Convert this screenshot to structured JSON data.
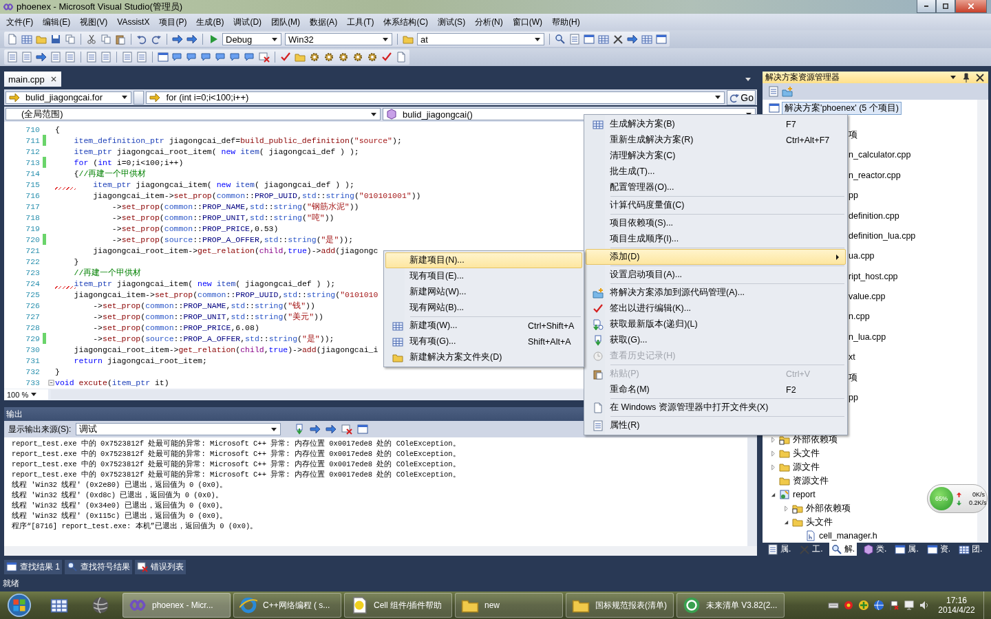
{
  "window": {
    "title": "phoenex - Microsoft Visual Studio(管理员)"
  },
  "menu": [
    "文件(F)",
    "编辑(E)",
    "视图(V)",
    "VAssistX",
    "项目(P)",
    "生成(B)",
    "调试(D)",
    "团队(M)",
    "数据(A)",
    "工具(T)",
    "体系结构(C)",
    "测试(S)",
    "分析(N)",
    "窗口(W)",
    "帮助(H)"
  ],
  "toolbar": {
    "configuration": "Debug",
    "platform": "Win32",
    "find": "at"
  },
  "document_tab": {
    "label": "main.cpp",
    "selected": true
  },
  "navigation": {
    "scope": "bulid_jiagongcai.for",
    "statement": "for (int i=0;i<100;i++)",
    "go": "Go",
    "context": "(全局范围)",
    "member": "bulid_jiagongcai()"
  },
  "code_lines": [
    {
      "number": "710",
      "changed": false,
      "squiggle": false,
      "fold": false,
      "tokens": [
        {
          "kind": "p",
          "text": "{"
        }
      ]
    },
    {
      "number": "711",
      "changed": true,
      "squiggle": false,
      "fold": false,
      "tokens": [
        {
          "kind": "ty",
          "text": "    item_definition_ptr"
        },
        {
          "kind": "p",
          "text": " jiagongcai_def="
        },
        {
          "kind": "fn",
          "text": "build_public_definition"
        },
        {
          "kind": "p",
          "text": "("
        },
        {
          "kind": "str",
          "text": "\"source\""
        },
        {
          "kind": "p",
          "text": ");"
        }
      ]
    },
    {
      "number": "712",
      "changed": false,
      "squiggle": false,
      "fold": false,
      "tokens": [
        {
          "kind": "ty",
          "text": "    item_ptr"
        },
        {
          "kind": "p",
          "text": " jiagongcai_root_item( "
        },
        {
          "kind": "kw",
          "text": "new"
        },
        {
          "kind": "ty",
          "text": " item"
        },
        {
          "kind": "p",
          "text": "( jiagongcai_def ) );"
        }
      ]
    },
    {
      "number": "713",
      "changed": true,
      "squiggle": false,
      "fold": false,
      "tokens": [
        {
          "kind": "kw",
          "text": "    for"
        },
        {
          "kind": "p",
          "text": " ("
        },
        {
          "kind": "kw",
          "text": "int"
        },
        {
          "kind": "p",
          "text": " i=0;i<100;i++)"
        }
      ]
    },
    {
      "number": "714",
      "changed": false,
      "squiggle": false,
      "fold": false,
      "tokens": [
        {
          "kind": "p",
          "text": "    {"
        },
        {
          "kind": "cmt",
          "text": "//再建一个甲供材"
        }
      ]
    },
    {
      "number": "715",
      "changed": false,
      "squiggle": true,
      "fold": false,
      "tokens": [
        {
          "kind": "ty",
          "text": "        item_ptr"
        },
        {
          "kind": "p",
          "text": " jiagongcai_item( "
        },
        {
          "kind": "kw",
          "text": "new"
        },
        {
          "kind": "ty",
          "text": " item"
        },
        {
          "kind": "p",
          "text": "( jiagongcai_def ) );"
        }
      ]
    },
    {
      "number": "716",
      "changed": false,
      "squiggle": false,
      "fold": false,
      "tokens": [
        {
          "kind": "p",
          "text": "        jiagongcai_item->"
        },
        {
          "kind": "fn",
          "text": "set_prop"
        },
        {
          "kind": "p",
          "text": "("
        },
        {
          "kind": "ns",
          "text": "common"
        },
        {
          "kind": "p",
          "text": "::"
        },
        {
          "kind": "mac",
          "text": "PROP_UUID"
        },
        {
          "kind": "p",
          "text": ","
        },
        {
          "kind": "ns",
          "text": "std"
        },
        {
          "kind": "p",
          "text": "::"
        },
        {
          "kind": "ns",
          "text": "string"
        },
        {
          "kind": "p",
          "text": "("
        },
        {
          "kind": "str",
          "text": "\"010101001\""
        },
        {
          "kind": "p",
          "text": "))"
        }
      ]
    },
    {
      "number": "717",
      "changed": false,
      "squiggle": false,
      "fold": false,
      "tokens": [
        {
          "kind": "p",
          "text": "            ->"
        },
        {
          "kind": "fn",
          "text": "set_prop"
        },
        {
          "kind": "p",
          "text": "("
        },
        {
          "kind": "ns",
          "text": "common"
        },
        {
          "kind": "p",
          "text": "::"
        },
        {
          "kind": "mac",
          "text": "PROP_NAME"
        },
        {
          "kind": "p",
          "text": ","
        },
        {
          "kind": "ns",
          "text": "std"
        },
        {
          "kind": "p",
          "text": "::"
        },
        {
          "kind": "ns",
          "text": "string"
        },
        {
          "kind": "p",
          "text": "("
        },
        {
          "kind": "str",
          "text": "\"钢筋水泥\""
        },
        {
          "kind": "p",
          "text": "))"
        }
      ]
    },
    {
      "number": "718",
      "changed": false,
      "squiggle": false,
      "fold": false,
      "tokens": [
        {
          "kind": "p",
          "text": "            ->"
        },
        {
          "kind": "fn",
          "text": "set_prop"
        },
        {
          "kind": "p",
          "text": "("
        },
        {
          "kind": "ns",
          "text": "common"
        },
        {
          "kind": "p",
          "text": "::"
        },
        {
          "kind": "mac",
          "text": "PROP_UNIT"
        },
        {
          "kind": "p",
          "text": ","
        },
        {
          "kind": "ns",
          "text": "std"
        },
        {
          "kind": "p",
          "text": "::"
        },
        {
          "kind": "ns",
          "text": "string"
        },
        {
          "kind": "p",
          "text": "("
        },
        {
          "kind": "str",
          "text": "\"吨\""
        },
        {
          "kind": "p",
          "text": "))"
        }
      ]
    },
    {
      "number": "719",
      "changed": false,
      "squiggle": false,
      "fold": false,
      "tokens": [
        {
          "kind": "p",
          "text": "            ->"
        },
        {
          "kind": "fn",
          "text": "set_prop"
        },
        {
          "kind": "p",
          "text": "("
        },
        {
          "kind": "ns",
          "text": "common"
        },
        {
          "kind": "p",
          "text": "::"
        },
        {
          "kind": "mac",
          "text": "PROP_PRICE"
        },
        {
          "kind": "p",
          "text": ",0.53)"
        }
      ]
    },
    {
      "number": "720",
      "changed": true,
      "squiggle": false,
      "fold": false,
      "tokens": [
        {
          "kind": "p",
          "text": "            ->"
        },
        {
          "kind": "fn",
          "text": "set_prop"
        },
        {
          "kind": "p",
          "text": "("
        },
        {
          "kind": "ns",
          "text": "source"
        },
        {
          "kind": "p",
          "text": "::"
        },
        {
          "kind": "mac",
          "text": "PROP_A_OFFER"
        },
        {
          "kind": "p",
          "text": ","
        },
        {
          "kind": "ns",
          "text": "std"
        },
        {
          "kind": "p",
          "text": "::"
        },
        {
          "kind": "ns",
          "text": "string"
        },
        {
          "kind": "p",
          "text": "("
        },
        {
          "kind": "str",
          "text": "\"是\""
        },
        {
          "kind": "p",
          "text": "));"
        }
      ]
    },
    {
      "number": "721",
      "changed": false,
      "squiggle": false,
      "fold": false,
      "tokens": [
        {
          "kind": "p",
          "text": "        jiagongcai_root_item->"
        },
        {
          "kind": "fn",
          "text": "get_relation"
        },
        {
          "kind": "p",
          "text": "("
        },
        {
          "kind": "var",
          "text": "child"
        },
        {
          "kind": "p",
          "text": ","
        },
        {
          "kind": "kw",
          "text": "true"
        },
        {
          "kind": "p",
          "text": ")->"
        },
        {
          "kind": "fn",
          "text": "add"
        },
        {
          "kind": "p",
          "text": "(jiagongc"
        }
      ]
    },
    {
      "number": "722",
      "changed": false,
      "squiggle": false,
      "fold": false,
      "tokens": [
        {
          "kind": "p",
          "text": "    }"
        }
      ]
    },
    {
      "number": "723",
      "changed": false,
      "squiggle": false,
      "fold": false,
      "tokens": [
        {
          "kind": "cmt",
          "text": "    //再建一个甲供材"
        }
      ]
    },
    {
      "number": "724",
      "changed": false,
      "squiggle": true,
      "fold": false,
      "tokens": [
        {
          "kind": "ty",
          "text": "    item_ptr"
        },
        {
          "kind": "p",
          "text": " jiagongcai_item( "
        },
        {
          "kind": "kw",
          "text": "new"
        },
        {
          "kind": "ty",
          "text": " item"
        },
        {
          "kind": "p",
          "text": "( jiagongcai_def ) );"
        }
      ]
    },
    {
      "number": "725",
      "changed": false,
      "squiggle": false,
      "fold": false,
      "tokens": [
        {
          "kind": "p",
          "text": "    jiagongcai_item->"
        },
        {
          "kind": "fn",
          "text": "set_prop"
        },
        {
          "kind": "p",
          "text": "("
        },
        {
          "kind": "ns",
          "text": "common"
        },
        {
          "kind": "p",
          "text": "::"
        },
        {
          "kind": "mac",
          "text": "PROP_UUID"
        },
        {
          "kind": "p",
          "text": ","
        },
        {
          "kind": "ns",
          "text": "std"
        },
        {
          "kind": "p",
          "text": "::"
        },
        {
          "kind": "ns",
          "text": "string"
        },
        {
          "kind": "p",
          "text": "("
        },
        {
          "kind": "str",
          "text": "\"0101010"
        }
      ]
    },
    {
      "number": "726",
      "changed": false,
      "squiggle": false,
      "fold": false,
      "tokens": [
        {
          "kind": "p",
          "text": "        ->"
        },
        {
          "kind": "fn",
          "text": "set_prop"
        },
        {
          "kind": "p",
          "text": "("
        },
        {
          "kind": "ns",
          "text": "common"
        },
        {
          "kind": "p",
          "text": "::"
        },
        {
          "kind": "mac",
          "text": "PROP_NAME"
        },
        {
          "kind": "p",
          "text": ","
        },
        {
          "kind": "ns",
          "text": "std"
        },
        {
          "kind": "p",
          "text": "::"
        },
        {
          "kind": "ns",
          "text": "string"
        },
        {
          "kind": "p",
          "text": "("
        },
        {
          "kind": "str",
          "text": "\"钱\""
        },
        {
          "kind": "p",
          "text": "))"
        }
      ]
    },
    {
      "number": "727",
      "changed": false,
      "squiggle": false,
      "fold": false,
      "tokens": [
        {
          "kind": "p",
          "text": "        ->"
        },
        {
          "kind": "fn",
          "text": "set_prop"
        },
        {
          "kind": "p",
          "text": "("
        },
        {
          "kind": "ns",
          "text": "common"
        },
        {
          "kind": "p",
          "text": "::"
        },
        {
          "kind": "mac",
          "text": "PROP_UNIT"
        },
        {
          "kind": "p",
          "text": ","
        },
        {
          "kind": "ns",
          "text": "std"
        },
        {
          "kind": "p",
          "text": "::"
        },
        {
          "kind": "ns",
          "text": "string"
        },
        {
          "kind": "p",
          "text": "("
        },
        {
          "kind": "str",
          "text": "\"美元\""
        },
        {
          "kind": "p",
          "text": "))"
        }
      ]
    },
    {
      "number": "728",
      "changed": false,
      "squiggle": false,
      "fold": false,
      "tokens": [
        {
          "kind": "p",
          "text": "        ->"
        },
        {
          "kind": "fn",
          "text": "set_prop"
        },
        {
          "kind": "p",
          "text": "("
        },
        {
          "kind": "ns",
          "text": "common"
        },
        {
          "kind": "p",
          "text": "::"
        },
        {
          "kind": "mac",
          "text": "PROP_PRICE"
        },
        {
          "kind": "p",
          "text": ",6.08)"
        }
      ]
    },
    {
      "number": "729",
      "changed": true,
      "squiggle": false,
      "fold": false,
      "tokens": [
        {
          "kind": "p",
          "text": "        ->"
        },
        {
          "kind": "fn",
          "text": "set_prop"
        },
        {
          "kind": "p",
          "text": "("
        },
        {
          "kind": "ns",
          "text": "source"
        },
        {
          "kind": "p",
          "text": "::"
        },
        {
          "kind": "mac",
          "text": "PROP_A_OFFER"
        },
        {
          "kind": "p",
          "text": ","
        },
        {
          "kind": "ns",
          "text": "std"
        },
        {
          "kind": "p",
          "text": "::"
        },
        {
          "kind": "ns",
          "text": "string"
        },
        {
          "kind": "p",
          "text": "("
        },
        {
          "kind": "str",
          "text": "\"是\""
        },
        {
          "kind": "p",
          "text": "));"
        }
      ]
    },
    {
      "number": "730",
      "changed": false,
      "squiggle": false,
      "fold": false,
      "tokens": [
        {
          "kind": "p",
          "text": "    jiagongcai_root_item->"
        },
        {
          "kind": "fn",
          "text": "get_relation"
        },
        {
          "kind": "p",
          "text": "("
        },
        {
          "kind": "var",
          "text": "child"
        },
        {
          "kind": "p",
          "text": ","
        },
        {
          "kind": "kw",
          "text": "true"
        },
        {
          "kind": "p",
          "text": ")->"
        },
        {
          "kind": "fn",
          "text": "add"
        },
        {
          "kind": "p",
          "text": "(jiagongcai_i"
        }
      ]
    },
    {
      "number": "731",
      "changed": false,
      "squiggle": false,
      "fold": false,
      "tokens": [
        {
          "kind": "kw",
          "text": "    return"
        },
        {
          "kind": "p",
          "text": " jiagongcai_root_item;"
        }
      ]
    },
    {
      "number": "732",
      "changed": false,
      "squiggle": false,
      "fold": false,
      "tokens": [
        {
          "kind": "p",
          "text": "}"
        }
      ]
    },
    {
      "number": "733",
      "changed": false,
      "squiggle": false,
      "fold": true,
      "tokens": [
        {
          "kind": "kw",
          "text": "void"
        },
        {
          "kind": "fn",
          "text": " excute"
        },
        {
          "kind": "p",
          "text": "("
        },
        {
          "kind": "ty",
          "text": "item_ptr"
        },
        {
          "kind": "p",
          "text": " it)"
        }
      ]
    }
  ],
  "zoom": "100 %",
  "output": {
    "title": "输出",
    "source_label": "显示输出来源(S):",
    "source": "调试",
    "lines": [
      "report_test.exe 中的 0x7523812f 处最可能的异常: Microsoft C++ 异常: 内存位置 0x0017ede8 处的 COleException。",
      "report_test.exe 中的 0x7523812f 处最可能的异常: Microsoft C++ 异常: 内存位置 0x0017ede8 处的 COleException。",
      "report_test.exe 中的 0x7523812f 处最可能的异常: Microsoft C++ 异常: 内存位置 0x0017ede8 处的 COleException。",
      "report_test.exe 中的 0x7523812f 处最可能的异常: Microsoft C++ 异常: 内存位置 0x0017ede8 处的 COleException。",
      "线程 'Win32 线程' (0x2e80) 已退出，返回值为 0 (0x0)。",
      "线程 'Win32 线程' (0xd8c) 已退出，返回值为 0 (0x0)。",
      "线程 'Win32 线程' (0x34e0) 已退出，返回值为 0 (0x0)。",
      "线程 'Win32 线程' (0x115c) 已退出，返回值为 0 (0x0)。",
      "程序“[8716] report_test.exe: 本机”已退出，返回值为 0 (0x0)。"
    ]
  },
  "bottom_tabs": [
    {
      "label": "查找结果 1",
      "selected": false
    },
    {
      "label": "查找符号结果",
      "selected": false
    },
    {
      "label": "错误列表",
      "selected": false
    }
  ],
  "status": "就绪",
  "solution_explorer": {
    "title": "解决方案资源管理器",
    "root": {
      "label": "解决方案'phoenex' (5 个项目)",
      "selected": true
    },
    "covered_rows": [
      "项",
      "n_calculator.cpp",
      "n_reactor.cpp",
      "pp",
      "definition.cpp",
      "definition_lua.cpp",
      "ua.cpp",
      "ript_host.cpp",
      "value.cpp",
      "n.cpp",
      "n_lua.cpp",
      "xt",
      "项",
      "pp"
    ],
    "tree": [
      {
        "kind": "group",
        "children": [
          {
            "kind": "refs",
            "label": "外部依赖项",
            "expandable": true,
            "expanded": false
          },
          {
            "kind": "folder",
            "label": "头文件",
            "expandable": true,
            "expanded": false
          },
          {
            "kind": "folder",
            "label": "源文件",
            "expandable": true,
            "expanded": false
          },
          {
            "kind": "folder",
            "label": "资源文件",
            "expandable": false,
            "expanded": false
          }
        ]
      },
      {
        "kind": "project",
        "label": "report",
        "expandable": true,
        "expanded": true,
        "children": [
          {
            "kind": "refs",
            "label": "外部依赖项",
            "expandable": true,
            "expanded": false
          },
          {
            "kind": "folder",
            "label": "头文件",
            "expandable": true,
            "expanded": true,
            "children": [
              {
                "kind": "file",
                "label": "cell_manager.h",
                "expandable": false,
                "expanded": false
              }
            ]
          }
        ]
      }
    ],
    "tabs": [
      {
        "label": "属.",
        "selected": false
      },
      {
        "label": "工.",
        "selected": false
      },
      {
        "label": "解.",
        "selected": true
      },
      {
        "label": "类.",
        "selected": false
      },
      {
        "label": "属.",
        "selected": false
      },
      {
        "label": "资.",
        "selected": false
      },
      {
        "label": "团.",
        "selected": false
      }
    ]
  },
  "context_menu": [
    {
      "kind": "item",
      "label": "生成解决方案(B)",
      "shortcut": "F7",
      "disabled": false,
      "selected": false,
      "submenu": false
    },
    {
      "kind": "item",
      "label": "重新生成解决方案(R)",
      "shortcut": "Ctrl+Alt+F7",
      "disabled": false,
      "selected": false,
      "submenu": false
    },
    {
      "kind": "item",
      "label": "清理解决方案(C)",
      "disabled": false,
      "selected": false,
      "submenu": false
    },
    {
      "kind": "item",
      "label": "批生成(T)...",
      "disabled": false,
      "selected": false,
      "submenu": false
    },
    {
      "kind": "item",
      "label": "配置管理器(O)...",
      "disabled": false,
      "selected": false,
      "submenu": false
    },
    {
      "kind": "separator"
    },
    {
      "kind": "item",
      "label": "计算代码度量值(C)",
      "disabled": false,
      "selected": false,
      "submenu": false
    },
    {
      "kind": "separator"
    },
    {
      "kind": "item",
      "label": "项目依赖项(S)...",
      "disabled": false,
      "selected": false,
      "submenu": false
    },
    {
      "kind": "item",
      "label": "项目生成顺序(I)...",
      "disabled": false,
      "selected": false,
      "submenu": false
    },
    {
      "kind": "separator"
    },
    {
      "kind": "item",
      "label": "添加(D)",
      "disabled": false,
      "selected": true,
      "submenu": true
    },
    {
      "kind": "separator"
    },
    {
      "kind": "item",
      "label": "设置启动项目(A)...",
      "disabled": false,
      "selected": false,
      "submenu": false
    },
    {
      "kind": "separator"
    },
    {
      "kind": "item",
      "label": "将解决方案添加到源代码管理(A)...",
      "disabled": false,
      "selected": false,
      "submenu": false
    },
    {
      "kind": "item",
      "label": "签出以进行编辑(K)...",
      "disabled": false,
      "selected": false,
      "submenu": false
    },
    {
      "kind": "item",
      "label": "获取最新版本(递归)(L)",
      "disabled": false,
      "selected": false,
      "submenu": false
    },
    {
      "kind": "item",
      "label": "获取(G)...",
      "disabled": false,
      "selected": false,
      "submenu": false
    },
    {
      "kind": "item",
      "label": "查看历史记录(H)",
      "disabled": true,
      "selected": false,
      "submenu": false
    },
    {
      "kind": "separator"
    },
    {
      "kind": "item",
      "label": "粘贴(P)",
      "shortcut": "Ctrl+V",
      "disabled": true,
      "selected": false,
      "submenu": false
    },
    {
      "kind": "item",
      "label": "重命名(M)",
      "shortcut": "F2",
      "disabled": false,
      "selected": false,
      "submenu": false
    },
    {
      "kind": "separator"
    },
    {
      "kind": "item",
      "label": "在 Windows 资源管理器中打开文件夹(X)",
      "disabled": false,
      "selected": false,
      "submenu": false
    },
    {
      "kind": "separator"
    },
    {
      "kind": "item",
      "label": "属性(R)",
      "disabled": false,
      "selected": false,
      "submenu": false
    }
  ],
  "submenu": [
    {
      "kind": "item",
      "label": "新建项目(N)...",
      "selected": true
    },
    {
      "kind": "item",
      "label": "现有项目(E)...",
      "selected": false
    },
    {
      "kind": "item",
      "label": "新建网站(W)...",
      "selected": false
    },
    {
      "kind": "item",
      "label": "现有网站(B)...",
      "selected": false
    },
    {
      "kind": "separator"
    },
    {
      "kind": "item",
      "label": "新建项(W)...",
      "shortcut": "Ctrl+Shift+A",
      "selected": false
    },
    {
      "kind": "item",
      "label": "现有项(G)...",
      "shortcut": "Shift+Alt+A",
      "selected": false
    },
    {
      "kind": "item",
      "label": "新建解决方案文件夹(D)",
      "selected": false
    }
  ],
  "network_monitor": {
    "load": "65%",
    "upload": "0K/s",
    "download": "0.2K/s"
  },
  "taskbar": {
    "tasks": [
      {
        "kind": "loop",
        "label": "phoenex - Micr...",
        "selected": true
      },
      {
        "kind": "ring",
        "label": "C++网络编程 ( s...",
        "selected": false
      },
      {
        "kind": "help",
        "label": "Cell 组件/插件帮助",
        "selected": false
      },
      {
        "kind": "folder",
        "label": "new",
        "selected": false
      },
      {
        "kind": "folder",
        "label": "国标规范报表(清单)",
        "selected": false
      },
      {
        "kind": "swirl",
        "label": "未来清单 V3.82(2...",
        "selected": false
      }
    ],
    "time": "17:16",
    "date": "2014/4/22"
  }
}
